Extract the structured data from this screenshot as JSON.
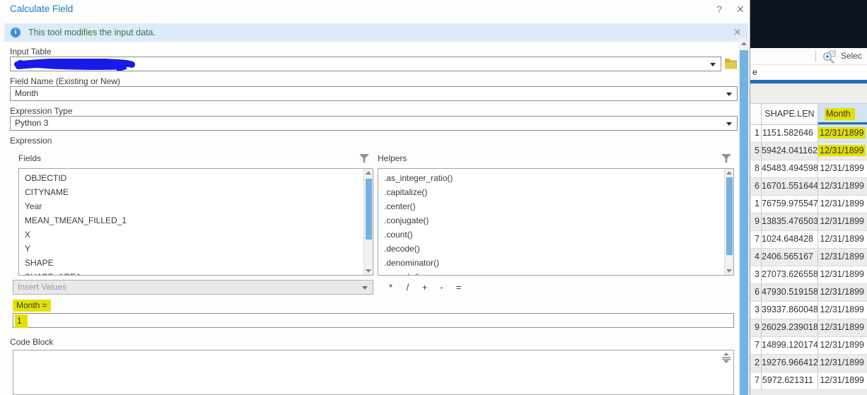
{
  "colors": {
    "accent_blue": "#1c7cc0",
    "tab_blue": "#1c72b8",
    "highlight_yellow": "#e3e103",
    "info_green": "#37763f",
    "info_bg": "#ddebf8",
    "info_blue": "#3f8fd6",
    "scrollbar_blue": "#73b2e1",
    "scribble_blue": "#1a1ae8",
    "dark_panel": "#0d1320",
    "header_month_bg": "#d3e3f3"
  },
  "dialog": {
    "title": "Calculate Field",
    "help_icon": "?",
    "close_icon": "✕",
    "info_bar": {
      "message": "This tool modifies the input data.",
      "close_icon": "✕"
    },
    "form": {
      "input_table_label": "Input Table",
      "field_name_label": "Field Name (Existing or New)",
      "field_name_value": "Month",
      "expression_type_label": "Expression Type",
      "expression_type_value": "Python 3",
      "expression_label": "Expression"
    },
    "builder": {
      "fields_label": "Fields",
      "helpers_label": "Helpers",
      "fields": [
        "OBJECTID",
        "CITYNAME",
        "Year",
        "MEAN_TMEAN_FILLED_1",
        "X",
        "Y",
        "SHAPE",
        "SHAPE_AREA"
      ],
      "helpers": [
        ".as_integer_ratio()",
        ".capitalize()",
        ".center()",
        ".conjugate()",
        ".count()",
        ".decode()",
        ".denominator()",
        ".encode()"
      ],
      "insert_values_label": "Insert Values",
      "operators": [
        "*",
        "/",
        "+",
        "-",
        "="
      ],
      "assignment_label": "Month =",
      "expression_value": "1",
      "code_block_label": "Code Block"
    }
  },
  "right_panel": {
    "toolbar": {
      "select_label": "Selec"
    },
    "tab_fragment": "e",
    "table": {
      "shape_len_header": "SHAPE.LEN",
      "month_header": "Month",
      "rows": [
        {
          "num": "1",
          "shape_len": "1151.582646",
          "month": "12/31/1899",
          "highlight": true,
          "selected": true
        },
        {
          "num": "5",
          "shape_len": "59424.041162",
          "month": "12/31/1899",
          "highlight": true
        },
        {
          "num": "8",
          "shape_len": "45483.494598",
          "month": "12/31/1899"
        },
        {
          "num": "6",
          "shape_len": "16701.551644",
          "month": "12/31/1899"
        },
        {
          "num": "1",
          "shape_len": "76759.975547",
          "month": "12/31/1899"
        },
        {
          "num": "9",
          "shape_len": "13835.476503",
          "month": "12/31/1899"
        },
        {
          "num": "7",
          "shape_len": "1024.648428",
          "month": "12/31/1899"
        },
        {
          "num": "4",
          "shape_len": "2406.565167",
          "month": "12/31/1899"
        },
        {
          "num": "3",
          "shape_len": "27073.626558",
          "month": "12/31/1899"
        },
        {
          "num": "6",
          "shape_len": "47930.519158",
          "month": "12/31/1899"
        },
        {
          "num": "3",
          "shape_len": "39337.860048",
          "month": "12/31/1899"
        },
        {
          "num": "9",
          "shape_len": "26029.239018",
          "month": "12/31/1899"
        },
        {
          "num": "7",
          "shape_len": "14899.120174",
          "month": "12/31/1899"
        },
        {
          "num": "2",
          "shape_len": "19276.966412",
          "month": "12/31/1899"
        },
        {
          "num": "7",
          "shape_len": "5972.621311",
          "month": "12/31/1899"
        }
      ]
    }
  }
}
